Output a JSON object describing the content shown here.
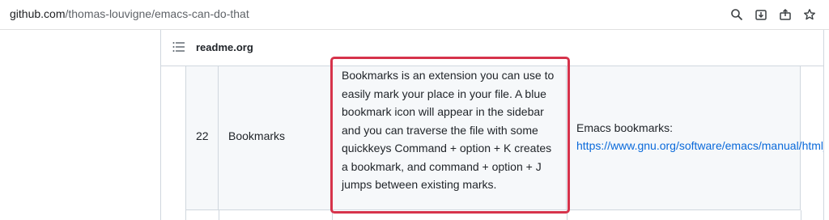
{
  "browser": {
    "url_host": "github.com",
    "url_path": "/thomas-louvigne/emacs-can-do-that",
    "icons": [
      "search-icon",
      "install-icon",
      "share-icon",
      "star-icon"
    ]
  },
  "readme": {
    "title": "readme.org"
  },
  "table": {
    "row": {
      "number": "22",
      "name": "Bookmarks",
      "description": "Bookmarks is an extension you can use to easily mark your place in your file. A blue bookmark icon will appear in the sidebar and you can traverse the file with some quickkeys Command + option + K creates a bookmark, and command + option + J jumps between existing marks.",
      "source_label": "Emacs bookmarks:",
      "source_link": "https://www.gnu.org/software/emacs/manual/html_node/emacs/Bookmarks.html"
    }
  },
  "colors": {
    "highlight_border": "#d6334b",
    "link": "#0969da",
    "cell_bg": "#f6f8fa"
  }
}
